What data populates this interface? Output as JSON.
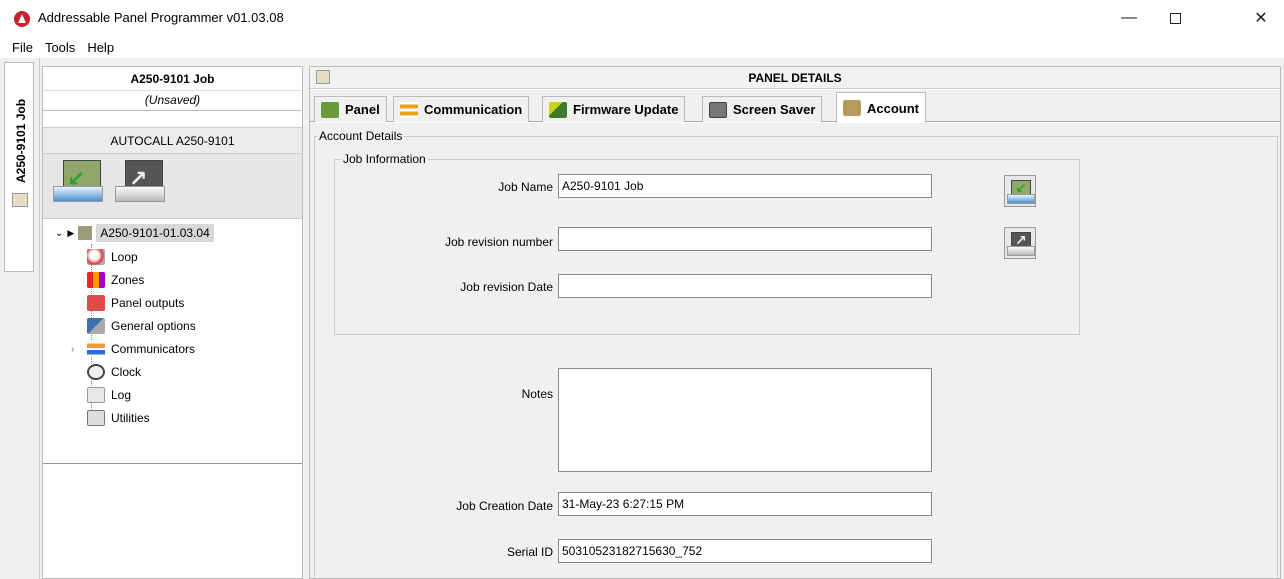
{
  "window": {
    "title": "Addressable Panel Programmer v01.03.08",
    "minimize": "—",
    "maximize": "",
    "close": "✕"
  },
  "menu": [
    "File",
    "Tools",
    "Help"
  ],
  "vertical_tab": {
    "label": "A250-9101 Job"
  },
  "left_panel": {
    "title": "A250-9101 Job",
    "subtitle": "(Unsaved)",
    "device_title": "AUTOCALL  A250-9101",
    "tree": {
      "root": "A250-9101-01.03.04",
      "items": [
        "Loop",
        "Zones",
        "Panel outputs",
        "General options",
        "Communicators",
        "Clock",
        "Log",
        "Utilities"
      ]
    }
  },
  "right_panel": {
    "title": "PANEL DETAILS",
    "tabs": [
      "Panel",
      "Communication",
      "Firmware Update",
      "Screen Saver",
      "Account"
    ],
    "active_tab": "Account",
    "account_details_label": "Account Details",
    "job_info_label": "Job Information",
    "fields": {
      "job_name": {
        "label": "Job Name",
        "value": "A250-9101 Job"
      },
      "job_revision_number": {
        "label": "Job revision number",
        "value": ""
      },
      "job_revision_date": {
        "label": "Job revision Date",
        "value": ""
      },
      "notes": {
        "label": "Notes",
        "value": ""
      },
      "job_creation_date": {
        "label": "Job Creation Date",
        "value": "31-May-23 6:27:15 PM"
      },
      "serial_id": {
        "label": "Serial ID",
        "value": "50310523182715630_752"
      }
    }
  },
  "colors": {
    "accent_red": "#c8202f",
    "arrow_green": "#2aa32a",
    "arrow_dark": "#333333"
  }
}
